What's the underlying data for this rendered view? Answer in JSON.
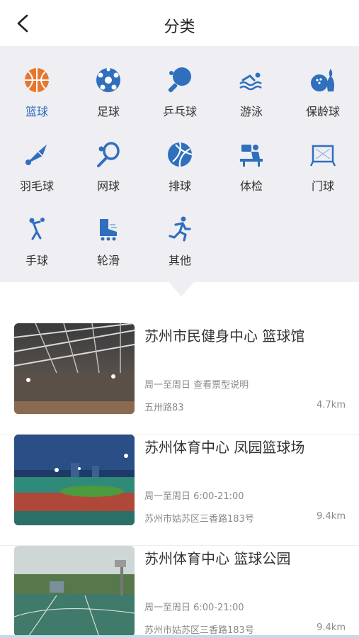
{
  "header": {
    "title": "分类"
  },
  "categories": [
    {
      "label": "篮球",
      "icon": "basketball-icon",
      "active": true
    },
    {
      "label": "足球",
      "icon": "soccer-icon"
    },
    {
      "label": "乒乓球",
      "icon": "ping-pong-icon"
    },
    {
      "label": "游泳",
      "icon": "swimming-icon"
    },
    {
      "label": "保龄球",
      "icon": "bowling-icon"
    },
    {
      "label": "羽毛球",
      "icon": "badminton-icon"
    },
    {
      "label": "网球",
      "icon": "tennis-icon"
    },
    {
      "label": "排球",
      "icon": "volleyball-icon"
    },
    {
      "label": "体检",
      "icon": "fitness-test-icon"
    },
    {
      "label": "门球",
      "icon": "gateball-icon"
    },
    {
      "label": "手球",
      "icon": "handball-icon"
    },
    {
      "label": "轮滑",
      "icon": "roller-skate-icon"
    },
    {
      "label": "其他",
      "icon": "running-icon"
    }
  ],
  "venues": [
    {
      "name": "苏州市民健身中心  篮球馆",
      "hours": "周一至周日 查看票型说明",
      "address": "五卅路83",
      "distance": "4.7km"
    },
    {
      "name": "苏州体育中心  凤园篮球场",
      "hours": "周一至周日 6:00-21:00",
      "address": "苏州市姑苏区三香路183号",
      "distance": "9.4km"
    },
    {
      "name": "苏州体育中心  篮球公园",
      "hours": "周一至周日 6:00-21:00",
      "address": "苏州市姑苏区三香路183号",
      "distance": "9.4km"
    }
  ],
  "colors": {
    "accent": "#2f6fbd",
    "active_icon": "#e8762c",
    "panel_bg": "#eeeef3"
  }
}
